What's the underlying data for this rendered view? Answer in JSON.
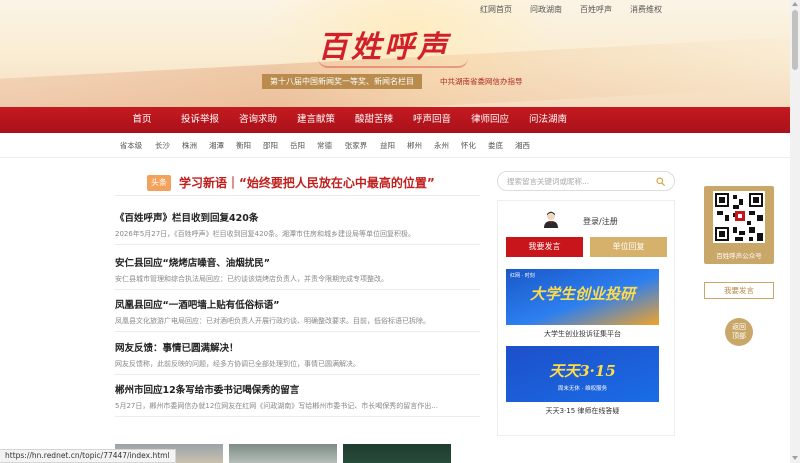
{
  "top_links": [
    "红网首页",
    "问政湖南",
    "百姓呼声",
    "消费维权"
  ],
  "banner": {
    "title": "百姓呼声",
    "award": "第十八届中国新闻奖一等奖、新闻名栏目",
    "guide": "中共湖南省委网信办指导"
  },
  "nav": [
    "首页",
    "投诉举报",
    "咨询求助",
    "建言献策",
    "酸甜苦辣",
    "呼声回音",
    "律师回应",
    "问法湖南"
  ],
  "cities": [
    "省本级",
    "长沙",
    "株洲",
    "湘潭",
    "衡阳",
    "邵阳",
    "岳阳",
    "常德",
    "张家界",
    "益阳",
    "郴州",
    "永州",
    "怀化",
    "娄底",
    "湘西"
  ],
  "headline": {
    "tag": "头条",
    "text": "学习新语｜“始终要把人民放在心中最高的位置”"
  },
  "news": [
    {
      "title": "《百姓呼声》栏目收到回复420条",
      "summary": "2026年5月27日，《百姓呼声》栏目收到回复420条。湘潭市住房和城乡建设局等单位回复积极。"
    },
    {
      "title": "安仁县回应“烧烤店噪音、油烟扰民”",
      "summary": "安仁县城市管理和综合执法局回应：已约谈该烧烤店负责人，并责令限期完成专项整改。"
    },
    {
      "title": "凤凰县回应“一酒吧墙上贴有低俗标语”",
      "summary": "凤凰县文化旅游广电局回应：已对酒吧负责人开展行政约谈、明确整改要求。目前，低俗标语已拆除。"
    },
    {
      "title": "网友反馈：事情已圆满解决！",
      "summary": "网友反馈称，此前反映的问题，经多方协调已全部处理到位，事情已圆满解决。"
    },
    {
      "title": "郴州市回应12条写给市委书记喝保秀的留言",
      "summary": "5月27日，郴州市委网信办就12位网友在红网《问政湖南》写给郴州市委书记、市长喝保秀的留言作出..."
    }
  ],
  "search": {
    "placeholder": "搜索留言关键词或昵称..."
  },
  "user": {
    "login": "登录/注册"
  },
  "buttons": {
    "speak": "我要发言",
    "unit_reply": "单位回复"
  },
  "promos": [
    {
      "big": "大学生创业投研",
      "small": "",
      "logo": "红网 · 时刻",
      "label": "大学生创业投诉征集平台"
    },
    {
      "big": "天天3·15",
      "small": "周末无休 · 维权服务",
      "logo": "",
      "label": "天天3·15 律师在线答疑"
    }
  ],
  "qr": {
    "caption": "百姓呼声公众号"
  },
  "side_speak": "我要发言",
  "back_top": [
    "返回",
    "顶部"
  ],
  "status_url": "https://hn.rednet.cn/topic/77447/index.html",
  "colors": {
    "brand_red": "#c8141b",
    "gold": "#c9a769",
    "headline_red": "#c0201d"
  }
}
